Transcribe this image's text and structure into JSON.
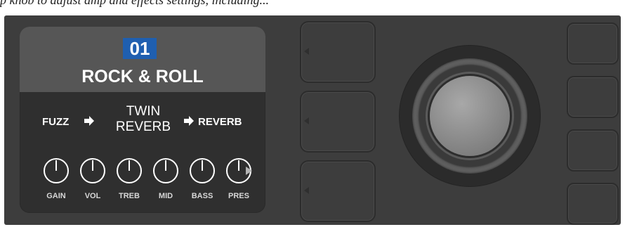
{
  "caption": {
    "text": "p knob to adjust amp and effects settings, including..."
  },
  "screen": {
    "preset_number": "01",
    "preset_name": "ROCK & ROLL",
    "signal_chain": {
      "fx1": "FUZZ",
      "amp_line1": "TWIN",
      "amp_line2": "REVERB",
      "fx2": "REVERB"
    },
    "knobs": [
      {
        "label": "GAIN"
      },
      {
        "label": "VOL"
      },
      {
        "label": "TREB"
      },
      {
        "label": "MID"
      },
      {
        "label": "BASS"
      },
      {
        "label": "PRES"
      }
    ],
    "more_icon": "triangle-right-icon"
  },
  "colors": {
    "panel": "#3d3d3d",
    "screen_bg": "#2f2f2f",
    "screen_header": "#565656",
    "preset_highlight": "#1f5fb0"
  }
}
